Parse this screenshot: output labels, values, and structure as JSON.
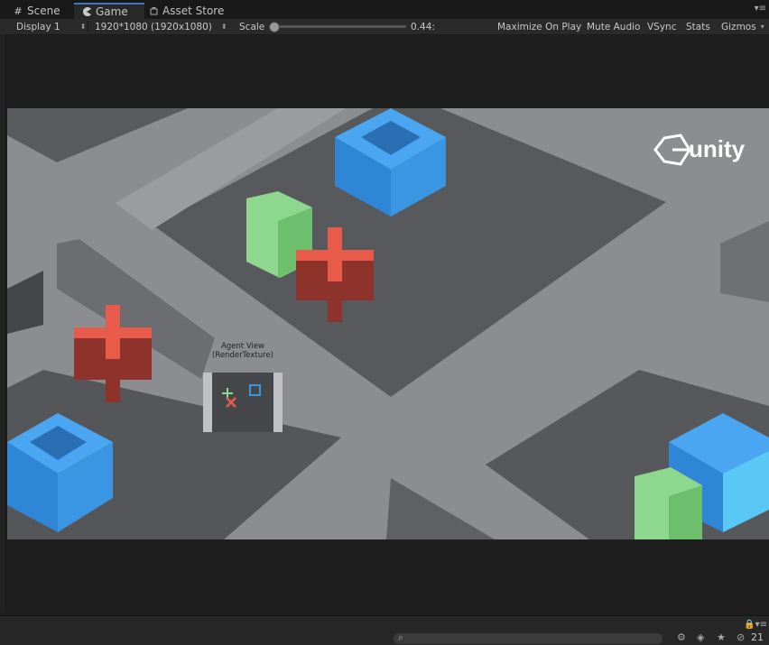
{
  "tabs": [
    {
      "label": "Scene",
      "icon": "grid-icon"
    },
    {
      "label": "Game",
      "icon": "pacman-icon"
    },
    {
      "label": "Asset Store",
      "icon": "bag-icon"
    }
  ],
  "toolbar": {
    "display": "Display 1",
    "resolution": "1920*1080 (1920x1080)",
    "scale_label": "Scale",
    "scale_value": "0.44:",
    "maximize": "Maximize On Play",
    "mute": "Mute Audio",
    "vsync": "VSync",
    "stats": "Stats",
    "gizmos": "Gizmos"
  },
  "viewport": {
    "logo_text": "unity",
    "agent_view_label": "Agent View",
    "agent_view_sublabel": "(RenderTexture)"
  },
  "status": {
    "count": "21",
    "colors": {
      "blue": "#3a8fd8",
      "green": "#7fd97f",
      "red": "#e85a4a",
      "darkred": "#8e332c"
    }
  }
}
